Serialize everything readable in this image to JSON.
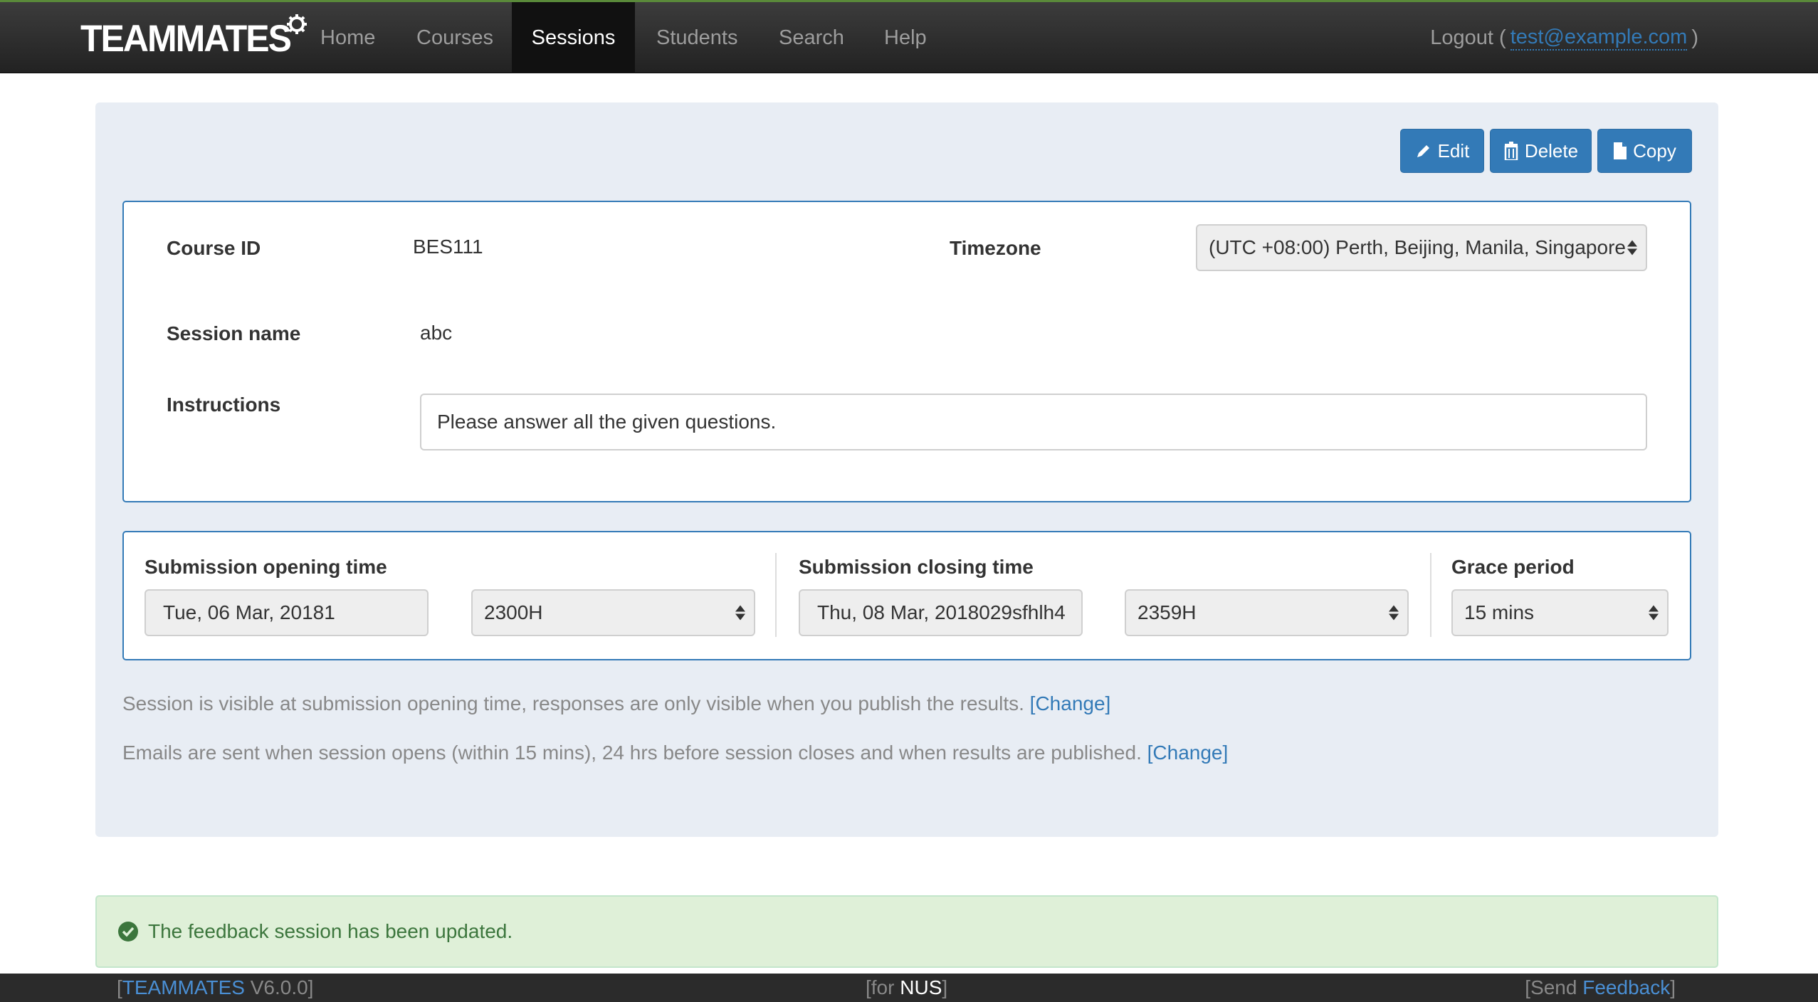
{
  "navbar": {
    "brand": "TEAMMATES",
    "items": [
      {
        "label": "Home"
      },
      {
        "label": "Courses"
      },
      {
        "label": "Sessions"
      },
      {
        "label": "Students"
      },
      {
        "label": "Search"
      },
      {
        "label": "Help"
      }
    ],
    "active_item": "Sessions",
    "logout_prefix": "Logout (",
    "user_email": "test@example.com",
    "logout_suffix": ")"
  },
  "actions": {
    "edit_label": "Edit",
    "delete_label": "Delete",
    "copy_label": "Copy"
  },
  "session": {
    "course_id_label": "Course ID",
    "course_id": "BES111",
    "timezone_label": "Timezone",
    "timezone": "(UTC +08:00) Perth, Beijing, Manila, Singapore",
    "session_name_label": "Session name",
    "session_name": "abc",
    "instructions_label": "Instructions",
    "instructions": "Please answer all the given questions."
  },
  "timing": {
    "opening_label": "Submission opening time",
    "opening_date": "Tue, 06 Mar, 20181",
    "opening_time": "2300H",
    "closing_label": "Submission closing time",
    "closing_date": "Thu, 08 Mar, 2018029sfhlh4",
    "closing_time": "2359H",
    "grace_label": "Grace period",
    "grace_period": "15 mins"
  },
  "notes": {
    "visibility_text": "Session is visible at submission opening time, responses are only visible when you publish the results.",
    "visibility_link": "[Change]",
    "email_text": "Emails are sent when session opens (within 15 mins), 24 hrs before session closes and when results are published.",
    "email_link": "[Change]"
  },
  "alert": {
    "message": "The feedback session has been updated.",
    "icon": "check-circle-icon",
    "color": "#3c763d"
  },
  "footer": {
    "app_name": "TEAMMATES",
    "version": "V6.0.0",
    "for_prefix": "for",
    "institution": "NUS",
    "send_prefix": "Send",
    "feedback_link": "Feedback"
  },
  "colors": {
    "accent": "#337ab7",
    "navbar_bg": "#222222",
    "panel_bg": "#e8edf4",
    "success_bg": "#dff0d8"
  }
}
